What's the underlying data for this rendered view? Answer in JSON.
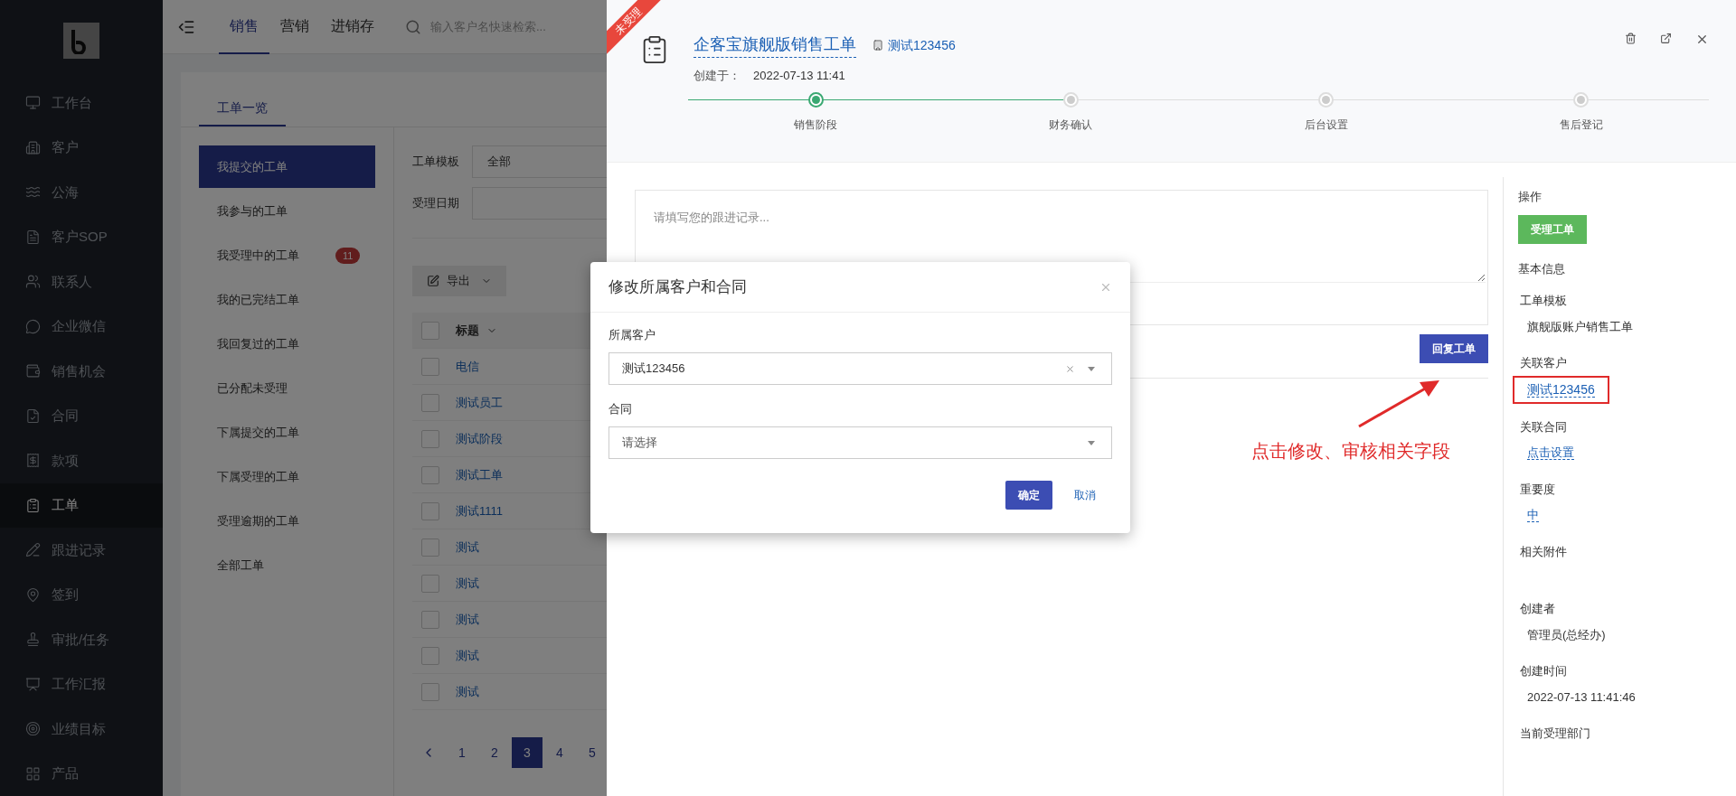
{
  "sidebar": {
    "items": [
      {
        "label": "工作台",
        "selected": false
      },
      {
        "label": "客户",
        "selected": false
      },
      {
        "label": "公海",
        "selected": false
      },
      {
        "label": "客户SOP",
        "selected": false
      },
      {
        "label": "联系人",
        "selected": false
      },
      {
        "label": "企业微信",
        "selected": false
      },
      {
        "label": "销售机会",
        "selected": false
      },
      {
        "label": "合同",
        "selected": false
      },
      {
        "label": "款项",
        "selected": false
      },
      {
        "label": "工单",
        "selected": true
      },
      {
        "label": "跟进记录",
        "selected": false
      },
      {
        "label": "签到",
        "selected": false
      },
      {
        "label": "审批/任务",
        "selected": false
      },
      {
        "label": "工作汇报",
        "selected": false
      },
      {
        "label": "业绩目标",
        "selected": false
      },
      {
        "label": "产品",
        "selected": false
      }
    ]
  },
  "top_nav": {
    "tabs": [
      {
        "label": "销售",
        "selected": true
      },
      {
        "label": "营销",
        "selected": false
      },
      {
        "label": "进销存",
        "selected": false
      }
    ],
    "search": {
      "placeholder": "输入客户名快速检索..."
    }
  },
  "page": {
    "tabs": [
      {
        "label": "工单一览",
        "selected": true
      }
    ],
    "menu": [
      {
        "label": "我提交的工单",
        "selected": true
      },
      {
        "label": "我参与的工单",
        "selected": false
      },
      {
        "label": "我受理中的工单",
        "selected": false,
        "badge": "11"
      },
      {
        "label": "我的已完结工单",
        "selected": false
      },
      {
        "label": "我回复过的工单",
        "selected": false
      },
      {
        "label": "已分配未受理",
        "selected": false
      },
      {
        "label": "下属提交的工单",
        "selected": false
      },
      {
        "label": "下属受理的工单",
        "selected": false
      },
      {
        "label": "受理逾期的工单",
        "selected": false
      },
      {
        "label": "全部工单",
        "selected": false
      }
    ],
    "filters": [
      {
        "label": "工单模板",
        "value": "全部"
      },
      {
        "label": "受理日期"
      }
    ],
    "export_button": "导出",
    "table": {
      "columns": [
        "标题"
      ],
      "select_all": {
        "checked": false
      },
      "rows": [
        {
          "title": "电信",
          "checked": false
        },
        {
          "title": "测试员工",
          "checked": false
        },
        {
          "title": "测试阶段",
          "checked": false
        },
        {
          "title": "测试工单",
          "checked": false
        },
        {
          "title": "测试1111",
          "checked": false
        },
        {
          "title": "测试",
          "checked": false
        },
        {
          "title": "测试",
          "checked": false
        },
        {
          "title": "测试",
          "checked": false
        },
        {
          "title": "测试",
          "checked": false
        },
        {
          "title": "测试",
          "checked": false
        }
      ]
    },
    "pagination": [
      {
        "label": "1",
        "selected": false
      },
      {
        "label": "2",
        "selected": false
      },
      {
        "label": "3",
        "selected": true
      },
      {
        "label": "4",
        "selected": false
      },
      {
        "label": "5",
        "selected": false
      }
    ]
  },
  "drawer": {
    "ribbon": "未受理",
    "title": "企客宝旗舰版销售工单",
    "customer": "测试123456",
    "created_label": "创建于：",
    "created_at": "2022-07-13 11:41",
    "steps": [
      {
        "label": "销售阶段",
        "selected": true
      },
      {
        "label": "财务确认",
        "selected": false
      },
      {
        "label": "后台设置",
        "selected": false
      },
      {
        "label": "售后登记",
        "selected": false
      }
    ],
    "reply": {
      "placeholder": "请填写您的跟进记录...",
      "button": "回复工单"
    },
    "side": {
      "actions_heading": "操作",
      "action_button": "受理工单",
      "info_heading": "基本信息",
      "fields": [
        {
          "label": "工单模板",
          "value": "旗舰版账户销售工单",
          "kind": "text",
          "highlighted": false
        },
        {
          "label": "关联客户",
          "value": "测试123456",
          "kind": "link",
          "highlighted": true
        },
        {
          "label": "关联合同",
          "value": "点击设置",
          "kind": "link",
          "highlighted": false
        },
        {
          "label": "重要度",
          "value": "中",
          "kind": "link",
          "highlighted": false
        },
        {
          "label": "相关附件",
          "highlighted": false
        },
        {
          "label": "创建者",
          "value": "管理员(总经办)",
          "kind": "text",
          "highlighted": false
        },
        {
          "label": "创建时间",
          "value": "2022-07-13 11:41:46",
          "kind": "text",
          "highlighted": false
        },
        {
          "label": "当前受理部门",
          "highlighted": false
        }
      ]
    }
  },
  "dialog": {
    "title": "修改所属客户和合同",
    "fields": [
      {
        "label": "所属客户",
        "value": "测试123456",
        "clearable": true
      },
      {
        "label": "合同",
        "placeholder": "请选择",
        "clearable": false
      }
    ],
    "ok": "确定",
    "cancel": "取消"
  },
  "annotation": {
    "text": "点击修改、审核相关字段"
  }
}
